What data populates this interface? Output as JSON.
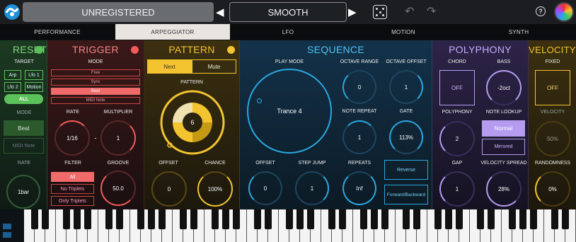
{
  "header": {
    "registration_label": "UNREGISTERED",
    "preset_prev": "◀",
    "preset_name": "SMOOTH",
    "preset_next": "▶",
    "help_label": "?"
  },
  "tabs": [
    {
      "label": "PERFORMANCE"
    },
    {
      "label": "ARPEGGIATOR",
      "active": true
    },
    {
      "label": "LFO"
    },
    {
      "label": "MOTION"
    },
    {
      "label": "SYNTH"
    }
  ],
  "reset": {
    "title": "RESET",
    "target_label": "TARGET",
    "targets": [
      "Arp",
      "Lfo 1",
      "Lfo 2",
      "Motion",
      "ALL"
    ],
    "mode_label": "MODE",
    "modes": [
      "Beat",
      "MIDI Note"
    ],
    "rate_label": "RATE",
    "rate_value": "1bar",
    "accent": "#5cc15a"
  },
  "trigger": {
    "title": "TRIGGER",
    "mode_label": "MODE",
    "modes": [
      "Free",
      "Sync",
      "Beat",
      "MIDI Note"
    ],
    "rate_label": "RATE",
    "rate_value": "1/16",
    "multiplier_label": "MULTIPLIER",
    "multiplier_value": "1",
    "separator": "-",
    "filter_label": "FILTER",
    "filters": [
      "All",
      "No Triplets",
      "Only Triplets"
    ],
    "groove_label": "GROOVE",
    "groove_value": "50.0",
    "accent": "#f25b5b"
  },
  "pattern": {
    "title": "PATTERN",
    "next_label": "Next",
    "mute_label": "Mute",
    "pattern_label": "PATTERN",
    "pattern_value": "6",
    "offset_label": "OFFSET",
    "offset_value": "0",
    "chance_label": "CHANCE",
    "chance_value": "100%",
    "accent": "#f4c430"
  },
  "sequence": {
    "title": "SEQUENCE",
    "play_mode_label": "PLAY MODE",
    "play_mode_value": "Trance 4",
    "octave_range_label": "OCTAVE RANGE",
    "octave_range_value": "0",
    "octave_offset_label": "OCTAVE OFFSET",
    "octave_offset_value": "1",
    "note_repeat_label": "NOTE REPEAT",
    "note_repeat_value": "1",
    "gate_label": "GATE",
    "gate_value": "113%",
    "offset_label": "OFFSET",
    "offset_value": "0",
    "step_jump_label": "STEP JUMP",
    "step_jump_value": "1",
    "repeats_label": "REPEATS",
    "repeats_value": "Inf",
    "reverse_label": "Reverse",
    "forward_backward_label": "Forward/Backward",
    "accent": "#2aa7e0"
  },
  "polyphony": {
    "title": "POLYPHONY",
    "chord_label": "CHORD",
    "chord_value": "OFF",
    "bass_label": "BASS",
    "bass_value": "-2oct",
    "polyphony_label": "POLYPHONY",
    "polyphony_value": "2",
    "note_lookup_label": "NOTE LOOKUP",
    "note_lookup_options": [
      "Normal",
      "Mirrored"
    ],
    "gap_label": "GAP",
    "gap_value": "1",
    "velocity_spread_label": "VELOCITY SPREAD",
    "velocity_spread_value": "28%",
    "accent": "#b59cf0"
  },
  "velocity": {
    "title": "VELOCITY",
    "fixed_label": "FIXED",
    "fixed_value": "OFF",
    "velocity_label": "VELOCITY",
    "velocity_value": "50%",
    "randomness_label": "RANDOMNESS",
    "randomness_value": "0%",
    "accent": "#f4c430"
  }
}
